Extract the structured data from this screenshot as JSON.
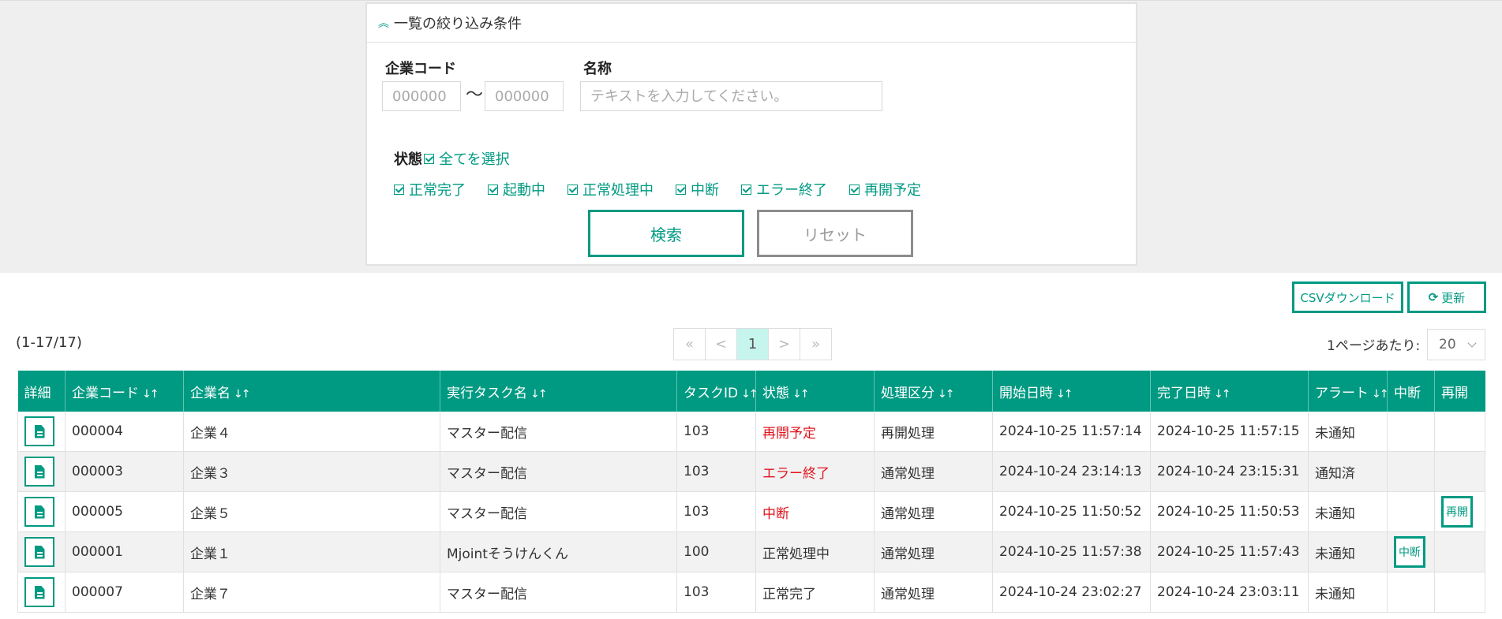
{
  "filter": {
    "title": "一覧の絞り込み条件",
    "company_code_label": "企業コード",
    "code_from_placeholder": "000000",
    "code_to_placeholder": "000000",
    "tilde": "〜",
    "name_label": "名称",
    "name_placeholder": "テキストを入力してください。",
    "status_label": "状態",
    "select_all_label": "全てを選択",
    "statuses": [
      "正常完了",
      "起動中",
      "正常処理中",
      "中断",
      "エラー終了",
      "再開予定"
    ],
    "search_button": "検索",
    "reset_button": "リセット"
  },
  "toolbar": {
    "csv_button": "CSVダウンロード",
    "refresh_button": "更新",
    "refresh_icon": "⟳"
  },
  "list": {
    "count": "(1-17/17)",
    "pager": {
      "first": "«",
      "prev": "<",
      "current": "1",
      "next": ">",
      "last": "»"
    },
    "per_page_label": "1ページあたり:",
    "per_page_value": "20"
  },
  "table": {
    "headers": [
      "詳細",
      "企業コード",
      "企業名",
      "実行タスク名",
      "タスクID",
      "状態",
      "処理区分",
      "開始日時",
      "完了日時",
      "アラート",
      "中断",
      "再開"
    ],
    "sort_icon": "↓↑",
    "rows": [
      {
        "code": "000004",
        "name": "企業４",
        "task": "マスター配信",
        "task_id": "103",
        "status": "再開予定",
        "status_alert": true,
        "kind": "再開処理",
        "start": "2024-10-25 11:57:14",
        "end": "2024-10-25 11:57:15",
        "alert": "未通知",
        "pause": "",
        "resume": ""
      },
      {
        "code": "000003",
        "name": "企業３",
        "task": "マスター配信",
        "task_id": "103",
        "status": "エラー終了",
        "status_alert": true,
        "kind": "通常処理",
        "start": "2024-10-24 23:14:13",
        "end": "2024-10-24 23:15:31",
        "alert": "通知済",
        "pause": "",
        "resume": ""
      },
      {
        "code": "000005",
        "name": "企業５",
        "task": "マスター配信",
        "task_id": "103",
        "status": "中断",
        "status_alert": true,
        "kind": "通常処理",
        "start": "2024-10-25 11:50:52",
        "end": "2024-10-25 11:50:53",
        "alert": "未通知",
        "pause": "",
        "resume": "再開"
      },
      {
        "code": "000001",
        "name": "企業１",
        "task": "Mjointそうけんくん",
        "task_id": "100",
        "status": "正常処理中",
        "status_alert": false,
        "kind": "通常処理",
        "start": "2024-10-25 11:57:38",
        "end": "2024-10-25 11:57:43",
        "alert": "未通知",
        "pause": "中断",
        "resume": ""
      },
      {
        "code": "000007",
        "name": "企業７",
        "task": "マスター配信",
        "task_id": "103",
        "status": "正常完了",
        "status_alert": false,
        "kind": "通常処理",
        "start": "2024-10-24 23:02:27",
        "end": "2024-10-24 23:03:11",
        "alert": "未通知",
        "pause": "",
        "resume": ""
      }
    ]
  },
  "colors": {
    "accent": "#009a82",
    "alert": "#e0141e"
  }
}
